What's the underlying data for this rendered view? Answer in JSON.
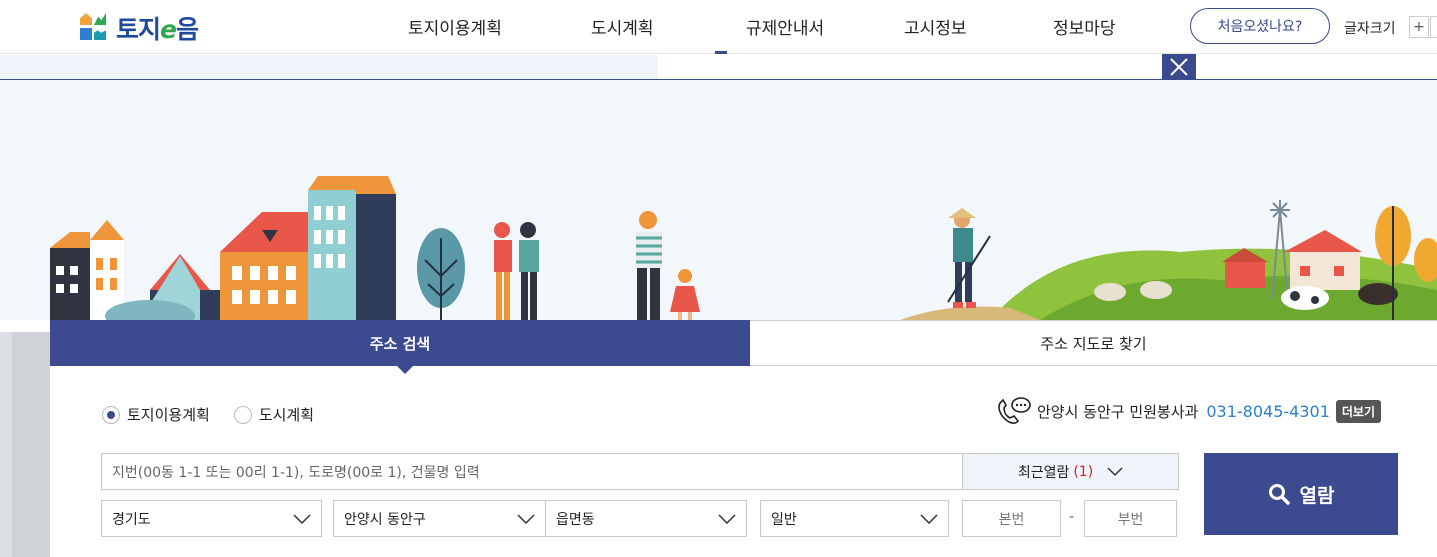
{
  "header": {
    "logo_text_a": "토지",
    "logo_text_e": "e",
    "logo_text_b": "음",
    "nav": [
      {
        "label": "토지이용계획"
      },
      {
        "label": "도시계획"
      },
      {
        "label": "규제안내서"
      },
      {
        "label": "고시정보"
      },
      {
        "label": "정보마당"
      }
    ],
    "first_visit": "처음오셨나요?",
    "font_size_label": "글자크기",
    "font_plus": "+",
    "font_minus": "-"
  },
  "tabs": {
    "address_search": "주소 검색",
    "map_search": "주소 지도로 찾기"
  },
  "search": {
    "radio_land": "토지이용계획",
    "radio_city": "도시계획",
    "contact_label": "안양시 동안구 민원봉사과",
    "contact_phone": "031-8045-4301",
    "more": "더보기",
    "placeholder": "지번(00동 1-1 또는 00리 1-1), 도로명(00로 1), 건물명 입력",
    "recent_label": "최근열람",
    "recent_count": "(1)",
    "open_label": "열람",
    "select_province": "경기도",
    "select_city": "안양시 동안구",
    "select_dong": "읍면동",
    "select_type": "일반",
    "main_no": "본번",
    "sub_no": "부번",
    "dash": "-"
  },
  "colors": {
    "primary": "#3c4a8f",
    "phone": "#2d7fd0",
    "count": "#d0262c"
  }
}
